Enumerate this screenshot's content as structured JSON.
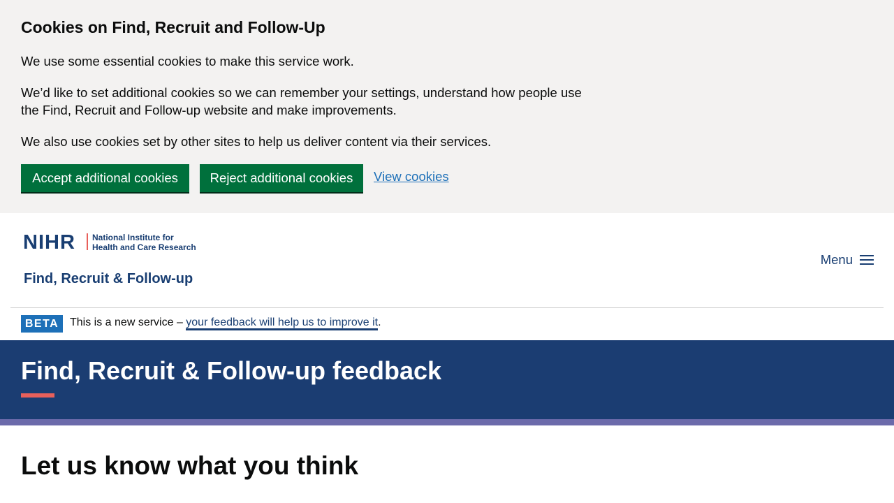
{
  "cookie_banner": {
    "title": "Cookies on Find, Recruit and Follow-Up",
    "paragraph_1": "We use some essential cookies to make this service work.",
    "paragraph_2": "We’d like to set additional cookies so we can remember your settings, understand how people use the Find, Recruit and Follow-up website and make improvements.",
    "paragraph_3": "We also use cookies set by other sites to help us deliver content via their services.",
    "accept_label": "Accept additional cookies",
    "reject_label": "Reject additional cookies",
    "view_label": "View cookies"
  },
  "header": {
    "logo": {
      "org_short": "NIHR",
      "org_line_1": "National Institute for",
      "org_line_2": "Health and Care Research",
      "service_name": "Find, Recruit & Follow-up"
    },
    "menu_label": "Menu",
    "menu_icon": "hamburger-icon"
  },
  "beta_banner": {
    "tag": "BETA",
    "text_before": "This is a new service – ",
    "link_text": "your feedback will help us to improve it",
    "text_after": "."
  },
  "hero": {
    "title": "Find, Recruit & Follow-up feedback"
  },
  "main": {
    "heading": "Let us know what you think"
  },
  "colors": {
    "banner_bg": "#f3f2f1",
    "button_green": "#00703c",
    "link_blue": "#1d70b8",
    "nihr_navy": "#1b3d72",
    "accent_red": "#e8605b",
    "band_purple": "#6b6aaa"
  }
}
